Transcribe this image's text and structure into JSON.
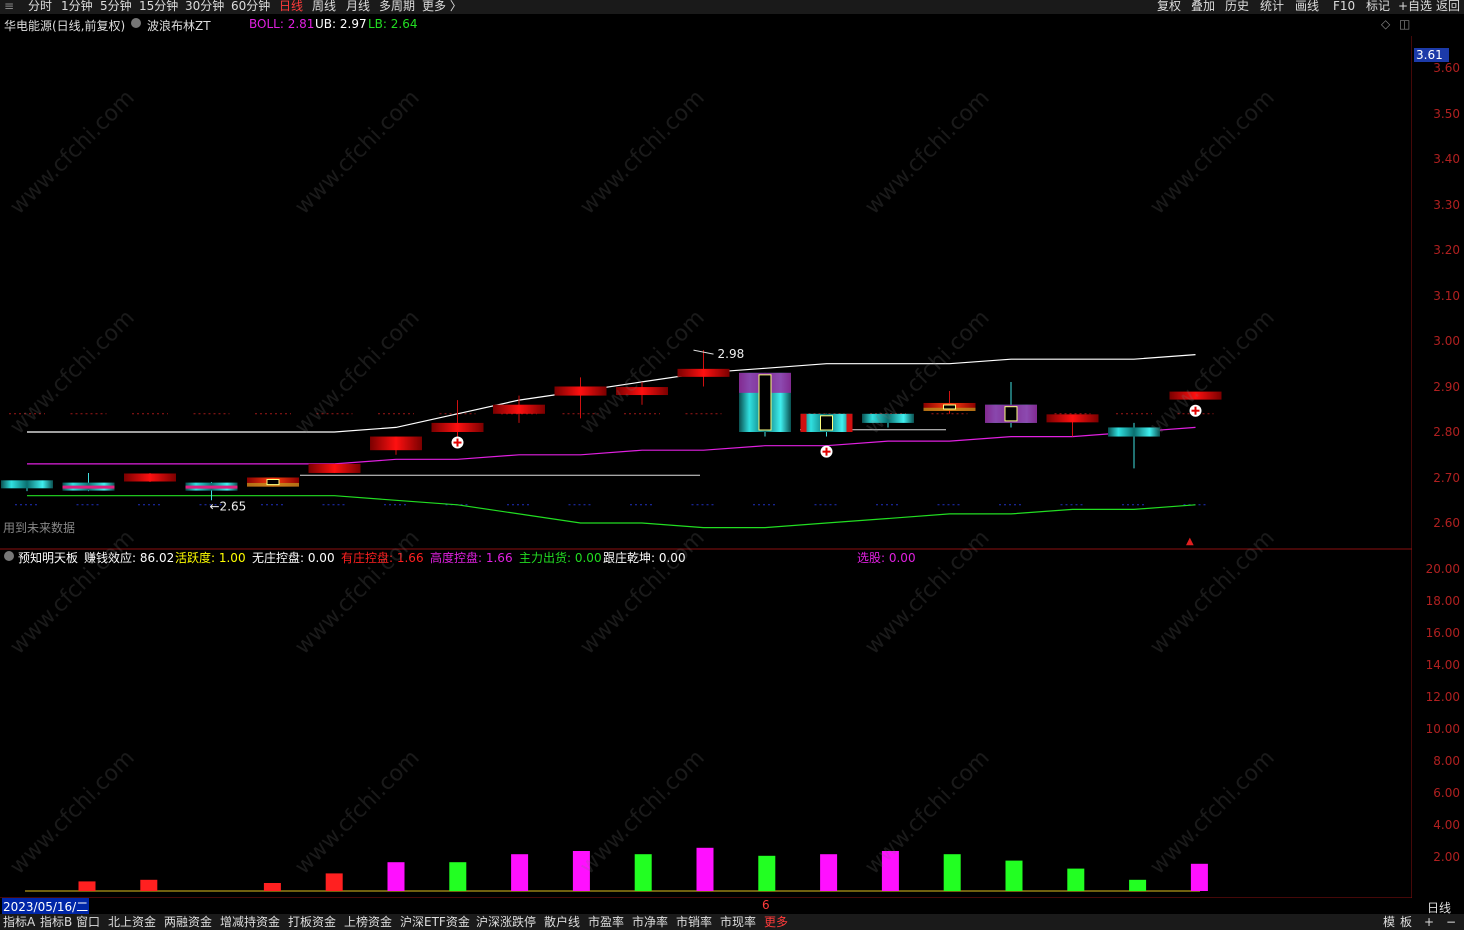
{
  "top_bar": {
    "periods": [
      "分时",
      "1分钟",
      "5分钟",
      "15分钟",
      "30分钟",
      "60分钟",
      "日线",
      "周线",
      "月线",
      "多周期",
      "更多 〉"
    ],
    "active_period": "日线",
    "right_buttons": [
      "复权",
      "叠加",
      "历史",
      "统计",
      "画线",
      "F10",
      "标记",
      "+自选",
      "返回"
    ]
  },
  "info_line": {
    "stock_name": "华电能源(日线,前复权)",
    "indicator_name": "波浪布林ZT",
    "boll_label": "BOLL: 2.81",
    "ub_label": "UB: 2.97",
    "lb_label": "LB: 2.64",
    "colors": {
      "boll": "#e020e0",
      "ub": "#ffffff",
      "lb": "#22dd22"
    }
  },
  "main_chart": {
    "future_data_note": "用到未来数据",
    "high_marker": "2.98",
    "low_marker": "2.65",
    "current_price": "3.61",
    "price_ticks": [
      "3.60",
      "3.50",
      "3.40",
      "3.30",
      "3.20",
      "3.10",
      "3.00",
      "2.90",
      "2.80",
      "2.70",
      "2.60"
    ]
  },
  "sub_panel": {
    "title": "预知明天板",
    "stats": [
      {
        "label": "赚钱效应: 86.02",
        "color": "#ffffff"
      },
      {
        "label": "活跃度: 1.00",
        "color": "#ffff00"
      },
      {
        "label": "无庄控盘: 0.00",
        "color": "#ffffff"
      },
      {
        "label": "有庄控盘: 1.66",
        "color": "#ff2020"
      },
      {
        "label": "高度控盘: 1.66",
        "color": "#e020e0"
      },
      {
        "label": "主力出货: 0.00",
        "color": "#22dd22"
      },
      {
        "label": "跟庄乾坤: 0.00",
        "color": "#ffffff"
      },
      {
        "label": "选股: 0.00",
        "color": "#e020e0"
      }
    ],
    "ticks": [
      "20.00",
      "18.00",
      "16.00",
      "14.00",
      "12.00",
      "10.00",
      "8.00",
      "6.00",
      "4.00",
      "2.00"
    ]
  },
  "date_label": "2023/05/16/二",
  "month_marker": "6",
  "right_panel_label": "日线",
  "bottom_bar": {
    "tabs": [
      "指标A",
      "指标B",
      "窗口",
      "北上资金",
      "两融资金",
      "增减持资金",
      "打板资金",
      "上榜资金",
      "沪深ETF资金",
      "沪深涨跌停",
      "散户线",
      "市盈率",
      "市净率",
      "市销率",
      "市现率",
      "更多"
    ],
    "right": [
      "模",
      "板",
      "+",
      "−"
    ]
  },
  "watermark": "www.cfchi.com",
  "chart_data": {
    "type": "candlestick",
    "title": "华电能源(日线,前复权)",
    "dates_note": "daily candles, last date 2023/05/16",
    "candles": [
      {
        "open": 2.68,
        "close": 2.69,
        "high": 2.69,
        "low": 2.67,
        "style": "cyan"
      },
      {
        "open": 2.68,
        "close": 2.68,
        "high": 2.71,
        "low": 2.67,
        "style": "mixed"
      },
      {
        "open": 2.7,
        "close": 2.7,
        "high": 2.71,
        "low": 2.69,
        "style": "red"
      },
      {
        "open": 2.68,
        "close": 2.68,
        "high": 2.69,
        "low": 2.65,
        "style": "mixed"
      },
      {
        "open": 2.68,
        "close": 2.7,
        "high": 2.7,
        "low": 2.68,
        "style": "red-yellow"
      },
      {
        "open": 2.71,
        "close": 2.73,
        "high": 2.73,
        "low": 2.71,
        "style": "red"
      },
      {
        "open": 2.76,
        "close": 2.79,
        "high": 2.79,
        "low": 2.75,
        "style": "red"
      },
      {
        "open": 2.8,
        "close": 2.82,
        "high": 2.87,
        "low": 2.79,
        "style": "red"
      },
      {
        "open": 2.84,
        "close": 2.86,
        "high": 2.88,
        "low": 2.82,
        "style": "red"
      },
      {
        "open": 2.88,
        "close": 2.9,
        "high": 2.92,
        "low": 2.83,
        "style": "red"
      },
      {
        "open": 2.89,
        "close": 2.89,
        "high": 2.91,
        "low": 2.86,
        "style": "red"
      },
      {
        "open": 2.93,
        "close": 2.93,
        "high": 2.98,
        "low": 2.9,
        "style": "red"
      },
      {
        "open": 2.93,
        "close": 2.8,
        "high": 2.93,
        "low": 2.79,
        "style": "cyan-magenta"
      },
      {
        "open": 2.84,
        "close": 2.8,
        "high": 2.84,
        "low": 2.79,
        "style": "cyan-red"
      },
      {
        "open": 2.84,
        "close": 2.82,
        "high": 2.84,
        "low": 2.81,
        "style": "cyan"
      },
      {
        "open": 2.86,
        "close": 2.85,
        "high": 2.89,
        "low": 2.84,
        "style": "red-yellow"
      },
      {
        "open": 2.86,
        "close": 2.82,
        "high": 2.91,
        "low": 2.81,
        "style": "cyan-magenta"
      },
      {
        "open": 2.83,
        "close": 2.83,
        "high": 2.83,
        "low": 2.79,
        "style": "red"
      },
      {
        "open": 2.81,
        "close": 2.79,
        "high": 2.82,
        "low": 2.72,
        "style": "cyan"
      },
      {
        "open": 2.88,
        "close": 2.88,
        "high": 2.88,
        "low": 2.88,
        "style": "red"
      }
    ],
    "boll_mid": [
      2.73,
      2.73,
      2.73,
      2.73,
      2.73,
      2.73,
      2.74,
      2.74,
      2.75,
      2.75,
      2.76,
      2.76,
      2.77,
      2.77,
      2.78,
      2.78,
      2.79,
      2.79,
      2.8,
      2.81
    ],
    "boll_upper": [
      2.8,
      2.8,
      2.8,
      2.8,
      2.8,
      2.8,
      2.81,
      2.84,
      2.87,
      2.89,
      2.91,
      2.93,
      2.94,
      2.95,
      2.95,
      2.95,
      2.96,
      2.96,
      2.96,
      2.97
    ],
    "boll_lower": [
      2.66,
      2.66,
      2.66,
      2.66,
      2.66,
      2.66,
      2.65,
      2.64,
      2.62,
      2.6,
      2.6,
      2.59,
      2.59,
      2.6,
      2.61,
      2.62,
      2.62,
      2.63,
      2.63,
      2.64
    ],
    "ylim": [
      2.55,
      3.62
    ],
    "sub_bars": [
      {
        "value": 0.6,
        "color": "#ff2020"
      },
      {
        "value": 0.7,
        "color": "#ff2020"
      },
      {
        "value": 0,
        "color": "#ff2020"
      },
      {
        "value": 0.5,
        "color": "#ff2020"
      },
      {
        "value": 1.1,
        "color": "#ff2020"
      },
      {
        "value": 1.8,
        "color": "#ff10ff"
      },
      {
        "value": 1.8,
        "color": "#22ff22"
      },
      {
        "value": 2.3,
        "color": "#ff10ff"
      },
      {
        "value": 2.5,
        "color": "#ff10ff"
      },
      {
        "value": 2.3,
        "color": "#22ff22"
      },
      {
        "value": 2.7,
        "color": "#ff10ff"
      },
      {
        "value": 2.2,
        "color": "#22ff22"
      },
      {
        "value": 2.3,
        "color": "#ff10ff"
      },
      {
        "value": 2.5,
        "color": "#ff10ff"
      },
      {
        "value": 2.3,
        "color": "#22ff22"
      },
      {
        "value": 1.9,
        "color": "#22ff22"
      },
      {
        "value": 1.4,
        "color": "#22ff22"
      },
      {
        "value": 0.7,
        "color": "#22ff22"
      },
      {
        "value": 1.7,
        "color": "#ff10ff"
      }
    ],
    "sub_ylim": [
      0,
      22
    ]
  }
}
